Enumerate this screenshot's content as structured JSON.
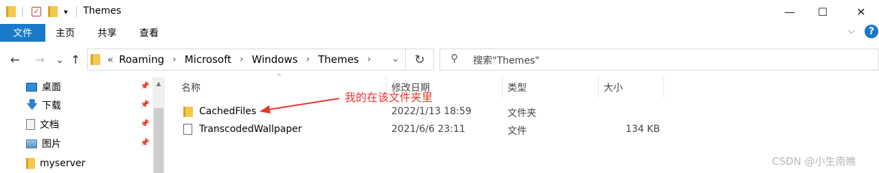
{
  "window": {
    "title": "Themes",
    "minimize_glyph": "—",
    "maximize_glyph": "☐",
    "close_glyph": "✕",
    "qa_chevron": "▾"
  },
  "ribbon": {
    "tabs": [
      "文件",
      "主页",
      "共享",
      "查看"
    ],
    "expand_glyph": "⌵",
    "help_glyph": "?"
  },
  "nav_buttons": {
    "back": "←",
    "forward": "→",
    "recent": "⌄",
    "up": "↑"
  },
  "address": {
    "overflow": "«",
    "crumbs": [
      "Roaming",
      "Microsoft",
      "Windows",
      "Themes"
    ],
    "separator": "›",
    "dropdown": "⌄",
    "refresh": "↻"
  },
  "search": {
    "placeholder": "搜索\"Themes\""
  },
  "nav_pane": {
    "items": [
      {
        "label": "桌面",
        "icon": "desktop-icon"
      },
      {
        "label": "下载",
        "icon": "download-icon"
      },
      {
        "label": "文档",
        "icon": "documents-icon"
      },
      {
        "label": "图片",
        "icon": "pictures-icon"
      },
      {
        "label": "myserver",
        "icon": "folder-icon"
      }
    ],
    "pin_glyph": "📌"
  },
  "columns": [
    "名称",
    "修改日期",
    "类型",
    "大小"
  ],
  "files": [
    {
      "name": "CachedFiles",
      "modified": "2022/1/13 18:59",
      "type": "文件夹",
      "size": "",
      "icon": "folder-icon"
    },
    {
      "name": "TranscodedWallpaper",
      "modified": "2021/6/6 23:11",
      "type": "文件",
      "size": "134 KB",
      "icon": "file-icon"
    }
  ],
  "annotation": {
    "text": "我的在该文件夹里",
    "color": "#e8352c"
  },
  "watermark": "CSDN @小生南瞧",
  "colors": {
    "accent": "#1979ca",
    "folder": "#f3c84b"
  }
}
